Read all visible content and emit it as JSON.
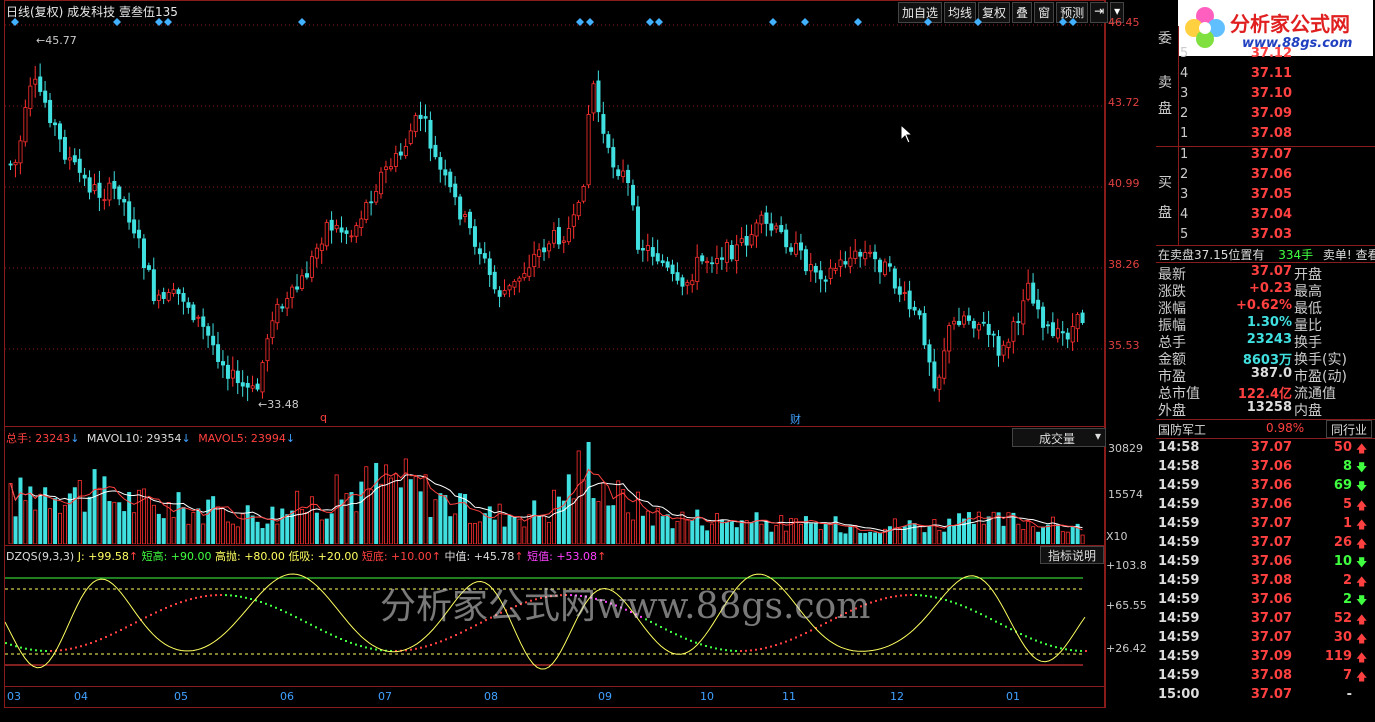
{
  "header": {
    "title": "日线(复权)  成发科技  壹叁伍135",
    "tools": [
      "加自选",
      "均线",
      "复权",
      "叠",
      "窗",
      "预测"
    ]
  },
  "price_axis": [
    "46.45",
    "43.72",
    "40.99",
    "38.26",
    "35.53"
  ],
  "annotations": {
    "high": "45.77",
    "low": "33.48",
    "mark1": "q",
    "mark2": "财"
  },
  "volume": {
    "total_label": "总手: 23243",
    "mavol10_label": "MAVOL10: 29354",
    "mavol5_label": "MAVOL5: 23994",
    "dropdown": "成交量",
    "axis": [
      "30829",
      "15574",
      "X10"
    ]
  },
  "indicator": {
    "name": "DZQS(9,3,3)",
    "j": "J: +99.58",
    "short_high": "短高: +90.00",
    "high_sell": "高抛: +80.00",
    "low_buy": "低吸: +20.00",
    "short_low": "短底: +10.00",
    "mid": "中值: +45.78",
    "short_val": "短值: +53.08",
    "help": "指标说明",
    "axis": [
      "+103.8",
      "+65.55",
      "+26.42"
    ]
  },
  "months": [
    "03",
    "04",
    "05",
    "06",
    "07",
    "08",
    "09",
    "10",
    "11",
    "12",
    "01"
  ],
  "watermark": "分析家公式网www.88gs.com",
  "logo": {
    "title": "分析家公式网",
    "url": "www.88gs.com"
  },
  "orderbook": {
    "wei_label": "委",
    "sell_label": "卖盘",
    "buy_label": "买盘",
    "sell": [
      {
        "n": "5",
        "p": "37.12"
      },
      {
        "n": "4",
        "p": "37.11"
      },
      {
        "n": "3",
        "p": "37.10"
      },
      {
        "n": "2",
        "p": "37.09"
      },
      {
        "n": "1",
        "p": "37.08"
      }
    ],
    "buy": [
      {
        "n": "1",
        "p": "37.07"
      },
      {
        "n": "2",
        "p": "37.06"
      },
      {
        "n": "3",
        "p": "37.05"
      },
      {
        "n": "4",
        "p": "37.04"
      },
      {
        "n": "5",
        "p": "37.03"
      }
    ],
    "status": "在卖盘37.15位置有",
    "status_qty": "334手",
    "status_tail": "卖单! 查看"
  },
  "quote": [
    {
      "l": "最新",
      "v": "37.07",
      "r": "开盘"
    },
    {
      "l": "涨跌",
      "v": "+0.23",
      "r": "最高"
    },
    {
      "l": "涨幅",
      "v": "+0.62%",
      "r": "最低"
    },
    {
      "l": "振幅",
      "v": "1.30%",
      "r": "量比"
    },
    {
      "l": "总手",
      "v": "23243",
      "r": "换手"
    },
    {
      "l": "金额",
      "v": "8603万",
      "r": "换手(实)"
    },
    {
      "l": "市盈",
      "v": "387.0",
      "r": "市盈(动)"
    },
    {
      "l": "总市值",
      "v": "122.4亿",
      "r": "流通值"
    },
    {
      "l": "外盘",
      "v": "13258",
      "r": "内盘"
    }
  ],
  "sector": {
    "name": "国防军工",
    "pct": "0.98%",
    "btn": "同行业"
  },
  "ticks": [
    {
      "t": "14:58",
      "p": "37.07",
      "q": "50",
      "d": "up"
    },
    {
      "t": "14:58",
      "p": "37.06",
      "q": "8",
      "d": "down"
    },
    {
      "t": "14:59",
      "p": "37.06",
      "q": "69",
      "d": "down"
    },
    {
      "t": "14:59",
      "p": "37.06",
      "q": "5",
      "d": "up"
    },
    {
      "t": "14:59",
      "p": "37.07",
      "q": "1",
      "d": "up"
    },
    {
      "t": "14:59",
      "p": "37.07",
      "q": "26",
      "d": "up"
    },
    {
      "t": "14:59",
      "p": "37.06",
      "q": "10",
      "d": "down"
    },
    {
      "t": "14:59",
      "p": "37.08",
      "q": "2",
      "d": "up"
    },
    {
      "t": "14:59",
      "p": "37.06",
      "q": "2",
      "d": "down"
    },
    {
      "t": "14:59",
      "p": "37.07",
      "q": "52",
      "d": "up"
    },
    {
      "t": "14:59",
      "p": "37.07",
      "q": "30",
      "d": "up"
    },
    {
      "t": "14:59",
      "p": "37.09",
      "q": "119",
      "d": "up"
    },
    {
      "t": "14:59",
      "p": "37.08",
      "q": "7",
      "d": "up"
    },
    {
      "t": "15:00",
      "p": "37.07",
      "q": "-",
      "d": "none"
    }
  ],
  "colors": {
    "up": "#ff3030",
    "down": "#40e0e0",
    "frame": "#8a1b1b",
    "accent": "#ff4040"
  }
}
